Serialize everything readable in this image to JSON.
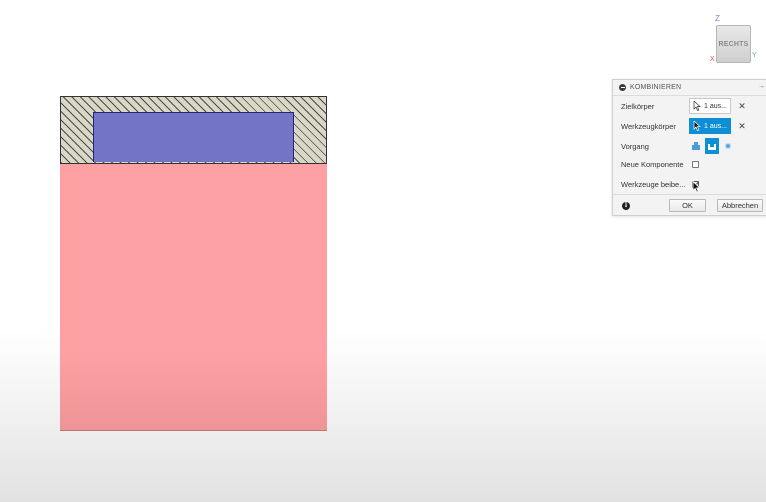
{
  "viewcube": {
    "face_label": "RECHTS",
    "axis_z": "Z",
    "axis_x": "X",
    "axis_y": "Y"
  },
  "combine_dialog": {
    "title": "KOMBINIEREN",
    "rows": {
      "target_label": "Zielkörper",
      "target_value": "1 aus...",
      "tool_label": "Werkzeugkörper",
      "tool_value": "1 aus...",
      "operation_label": "Vorgang",
      "new_component_label": "Neue Komponente",
      "keep_tools_label": "Werkzeuge beibe..."
    },
    "new_component_checked": false,
    "keep_tools_checked": true,
    "ok_label": "OK",
    "cancel_label": "Abbrechen"
  },
  "colors": {
    "target_body": "#fea1a5",
    "tool_body": "#7474c4",
    "section_hatch": "#d9d7c6",
    "accent": "#0f8fd3"
  }
}
